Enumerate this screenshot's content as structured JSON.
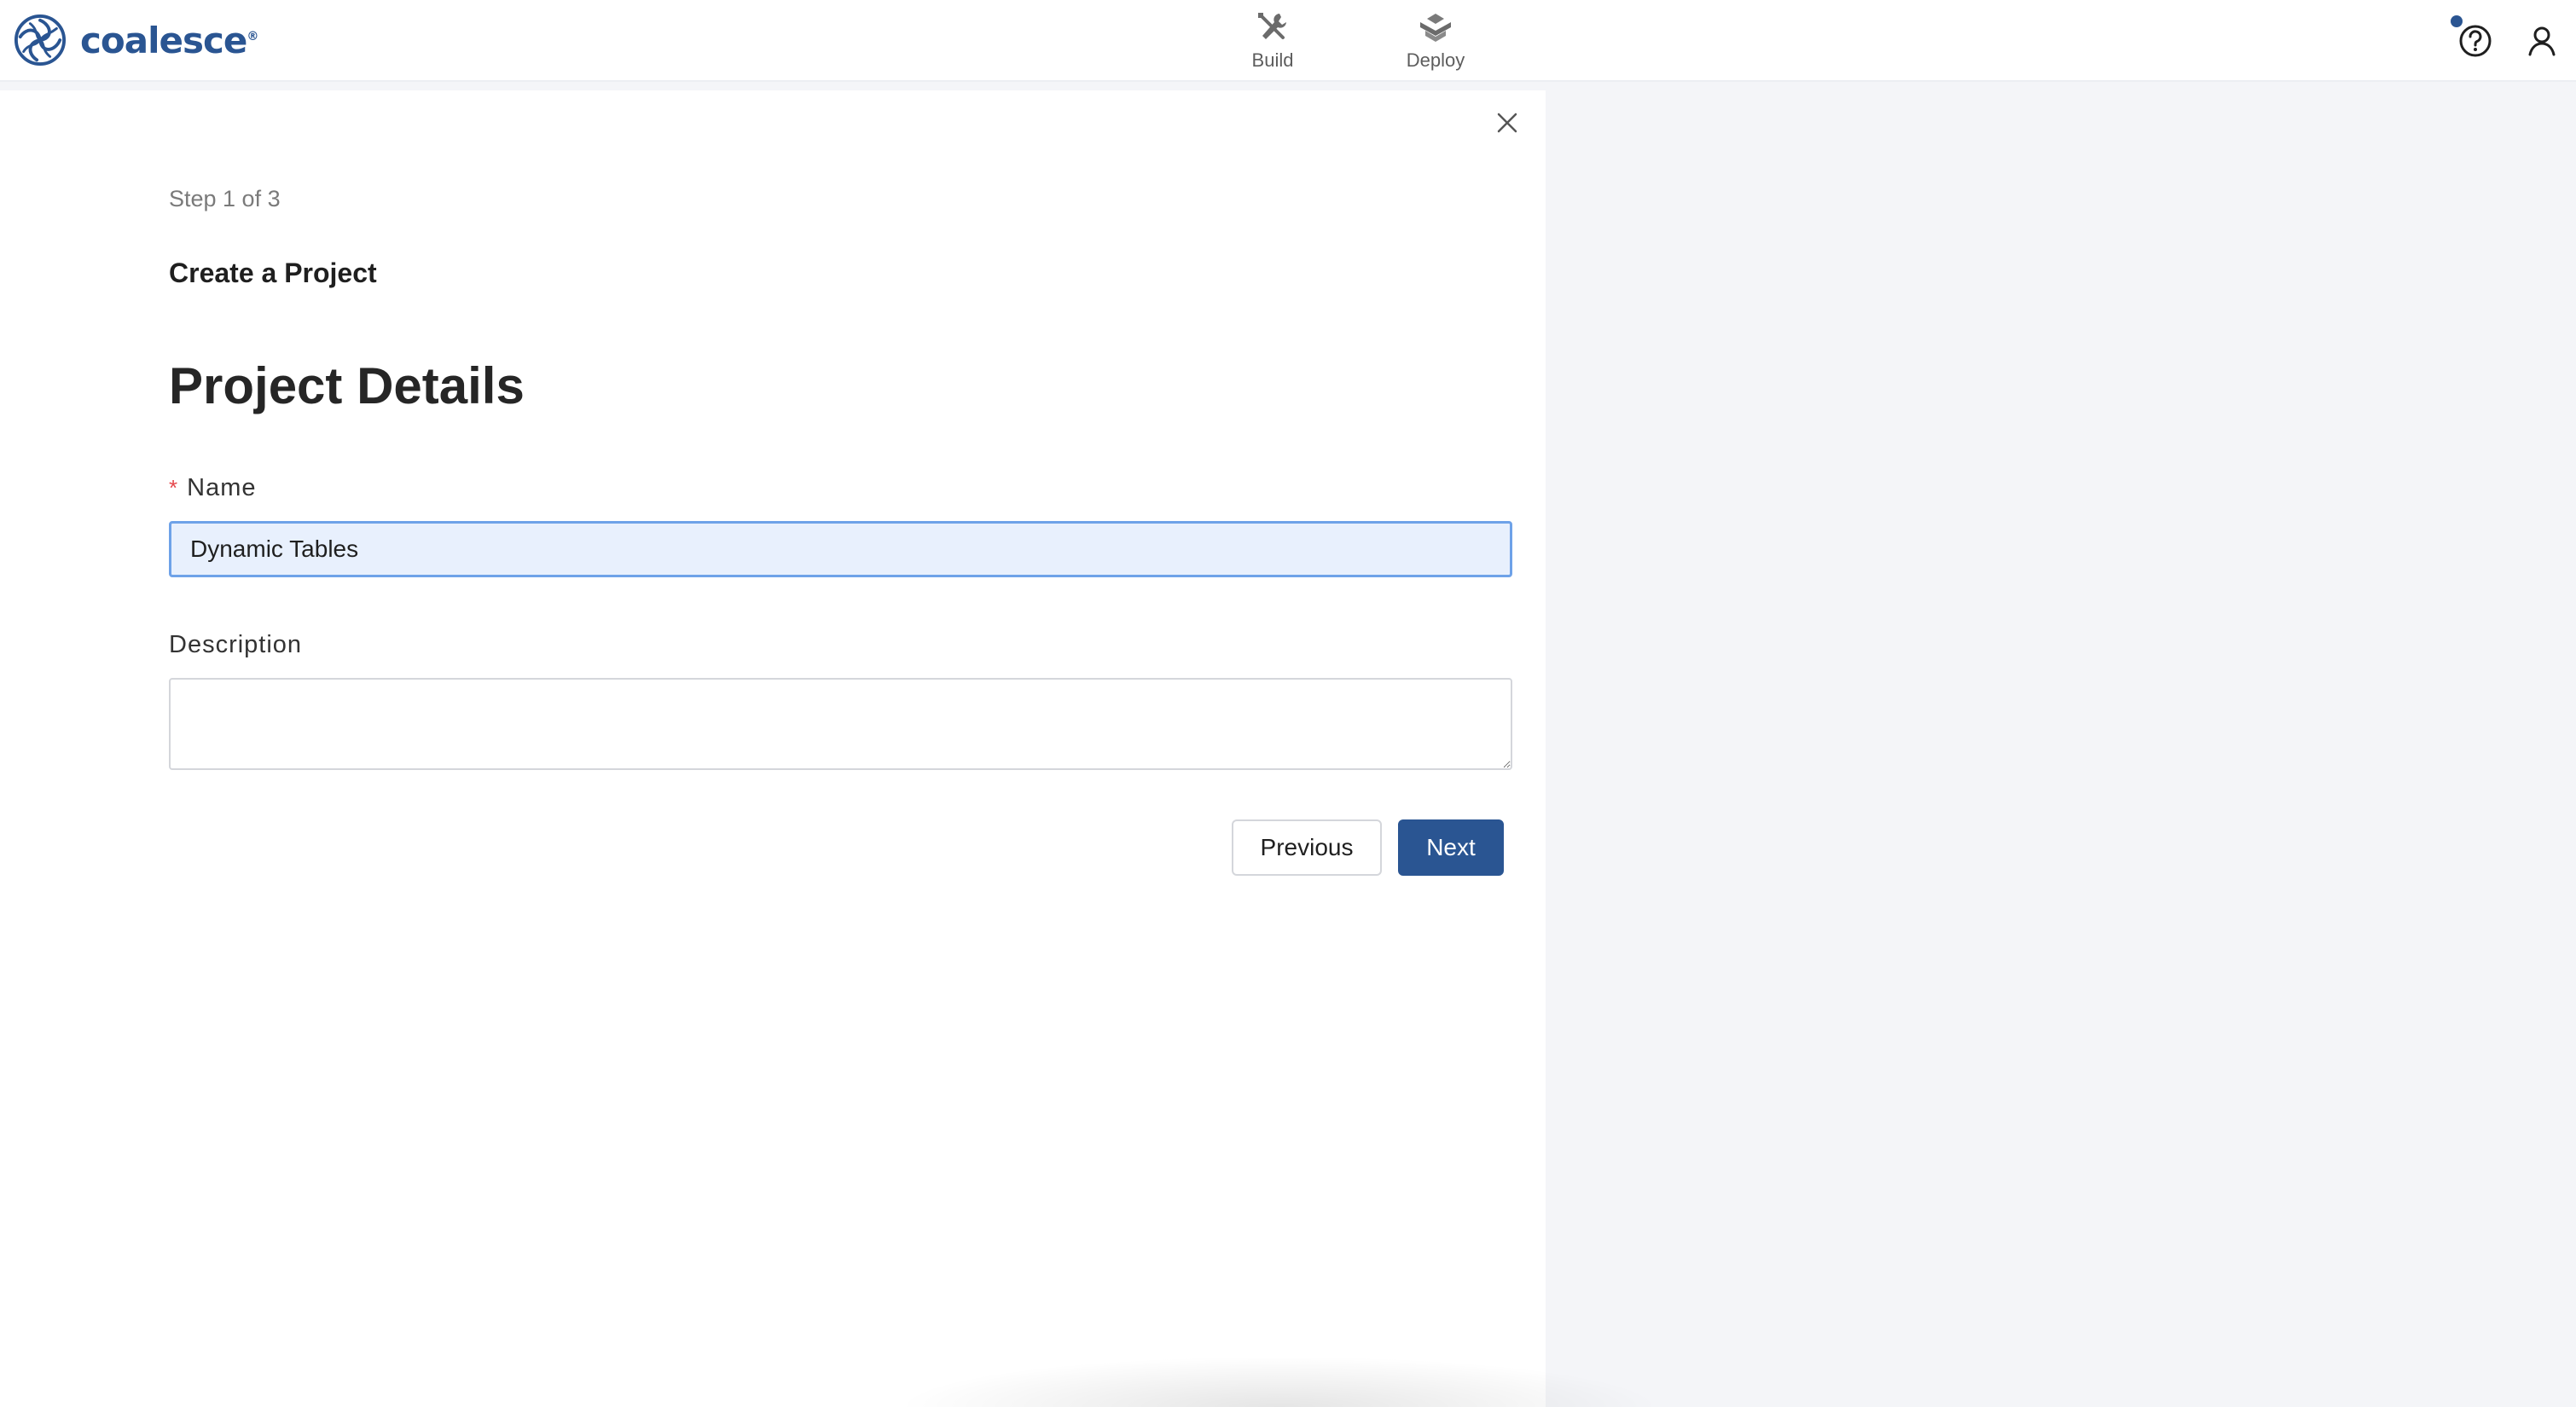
{
  "app": {
    "brand_name": "coalesce",
    "brand_mark": "®",
    "brand_color": "#2a5592"
  },
  "nav": {
    "items": [
      {
        "label": "Build",
        "icon": "tools-icon"
      },
      {
        "label": "Deploy",
        "icon": "deploy-icon"
      }
    ]
  },
  "header_actions": {
    "help_icon": "help-circle-icon",
    "user_icon": "user-icon",
    "has_notification": true
  },
  "wizard": {
    "step": "Step 1 of 3",
    "title": "Create a Project",
    "section_title": "Project Details",
    "close_icon": "close-icon",
    "fields": {
      "name": {
        "label": "Name",
        "required_mark": "*",
        "value": "Dynamic Tables"
      },
      "description": {
        "label": "Description",
        "value": ""
      }
    },
    "buttons": {
      "previous": "Previous",
      "next": "Next"
    }
  },
  "colors": {
    "primary": "#2a5592",
    "required": "#e5484d",
    "input_focus_bg": "#e8f0fd",
    "input_focus_border": "#6ea2e8",
    "panel_bg": "#ffffff",
    "page_bg": "#f4f5f8"
  }
}
